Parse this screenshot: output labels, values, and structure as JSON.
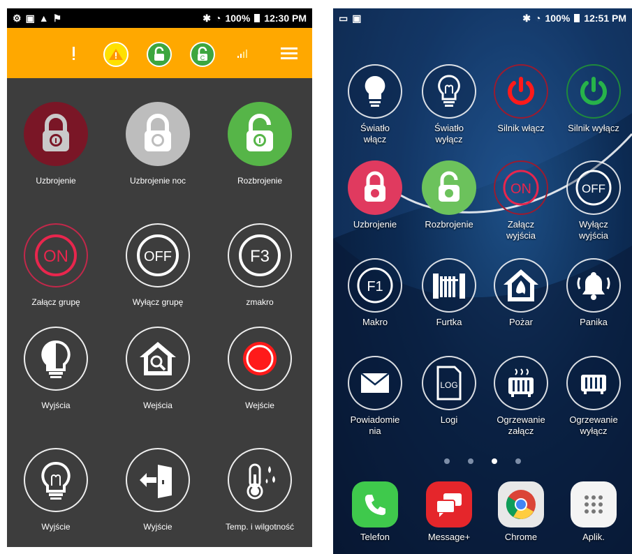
{
  "left_phone": {
    "status_bar": {
      "battery": "100%",
      "time": "12:30 PM"
    },
    "app_bar": {
      "icons": [
        "exclamation-icon",
        "warning-icon",
        "unlock-icon",
        "unlock-alt-icon",
        "signal-icon",
        "menu-icon"
      ]
    },
    "tiles": [
      {
        "label": "Uzbrojenie",
        "icon": "lock-icon"
      },
      {
        "label": "Uzbrojenie noc",
        "icon": "lock-icon"
      },
      {
        "label": "Rozbrojenie",
        "icon": "unlock-icon"
      },
      {
        "label": "Załącz grupę",
        "icon": "on-icon"
      },
      {
        "label": "Wyłącz grupę",
        "icon": "off-icon"
      },
      {
        "label": "zmakro",
        "icon": "f3-icon"
      },
      {
        "label": "Wyjścia",
        "icon": "bulb-icon"
      },
      {
        "label": "Wejścia",
        "icon": "house-search-icon"
      },
      {
        "label": "Wejście",
        "icon": "record-icon"
      },
      {
        "label": "Wyjście",
        "icon": "bulb-icon"
      },
      {
        "label": "Wyjście",
        "icon": "door-exit-icon"
      },
      {
        "label": "Temp. i wilgotność",
        "icon": "thermometer-icon"
      }
    ]
  },
  "right_phone": {
    "status_bar": {
      "battery": "100%",
      "time": "12:51 PM"
    },
    "icons": [
      {
        "label": "Światło\nwłącz",
        "icon": "bulb-icon"
      },
      {
        "label": "Światło\nwyłącz",
        "icon": "bulb-outline-icon"
      },
      {
        "label": "Silnik włącz",
        "icon": "power-icon"
      },
      {
        "label": "Silnik wyłącz",
        "icon": "power-icon"
      },
      {
        "label": "Uzbrojenie",
        "icon": "lock-icon"
      },
      {
        "label": "Rozbrojenie",
        "icon": "unlock-icon"
      },
      {
        "label": "Załącz\nwyjścia",
        "icon": "on-icon"
      },
      {
        "label": "Wyłącz\nwyjścia",
        "icon": "off-icon"
      },
      {
        "label": "Makro",
        "icon": "f1-icon"
      },
      {
        "label": "Furtka",
        "icon": "gate-icon"
      },
      {
        "label": "Pożar",
        "icon": "fire-icon"
      },
      {
        "label": "Panika",
        "icon": "bell-icon"
      },
      {
        "label": "Powiadomie\nnia",
        "icon": "envelope-icon"
      },
      {
        "label": "Logi",
        "icon": "log-icon"
      },
      {
        "label": "Ogrzewanie\nzałącz",
        "icon": "heater-icon"
      },
      {
        "label": "Ogrzewanie\nwyłącz",
        "icon": "heater-icon"
      }
    ],
    "page_indicator": {
      "count": 4,
      "active": 2
    },
    "dock": [
      {
        "label": "Telefon",
        "icon": "phone-icon"
      },
      {
        "label": "Message+",
        "icon": "message-icon"
      },
      {
        "label": "Chrome",
        "icon": "chrome-icon"
      },
      {
        "label": "Aplik.",
        "icon": "apps-grid-icon"
      }
    ]
  },
  "colors": {
    "accent_orange": "#ffa800",
    "lock_red": "#8b1a2c",
    "on_red": "#e8264d",
    "unlock_green": "#56b548",
    "power_red": "#ff1a1a",
    "power_green": "#27b34a"
  }
}
